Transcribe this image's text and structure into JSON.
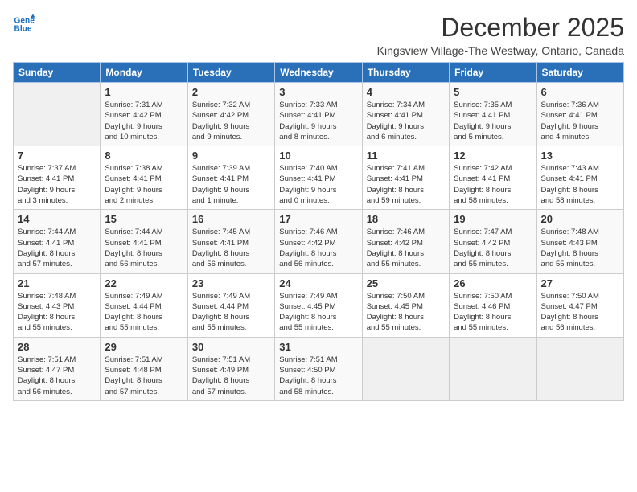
{
  "logo": {
    "line1": "General",
    "line2": "Blue"
  },
  "title": "December 2025",
  "location": "Kingsview Village-The Westway, Ontario, Canada",
  "days_of_week": [
    "Sunday",
    "Monday",
    "Tuesday",
    "Wednesday",
    "Thursday",
    "Friday",
    "Saturday"
  ],
  "weeks": [
    [
      {
        "day": "",
        "info": ""
      },
      {
        "day": "1",
        "info": "Sunrise: 7:31 AM\nSunset: 4:42 PM\nDaylight: 9 hours\nand 10 minutes."
      },
      {
        "day": "2",
        "info": "Sunrise: 7:32 AM\nSunset: 4:42 PM\nDaylight: 9 hours\nand 9 minutes."
      },
      {
        "day": "3",
        "info": "Sunrise: 7:33 AM\nSunset: 4:41 PM\nDaylight: 9 hours\nand 8 minutes."
      },
      {
        "day": "4",
        "info": "Sunrise: 7:34 AM\nSunset: 4:41 PM\nDaylight: 9 hours\nand 6 minutes."
      },
      {
        "day": "5",
        "info": "Sunrise: 7:35 AM\nSunset: 4:41 PM\nDaylight: 9 hours\nand 5 minutes."
      },
      {
        "day": "6",
        "info": "Sunrise: 7:36 AM\nSunset: 4:41 PM\nDaylight: 9 hours\nand 4 minutes."
      }
    ],
    [
      {
        "day": "7",
        "info": "Sunrise: 7:37 AM\nSunset: 4:41 PM\nDaylight: 9 hours\nand 3 minutes."
      },
      {
        "day": "8",
        "info": "Sunrise: 7:38 AM\nSunset: 4:41 PM\nDaylight: 9 hours\nand 2 minutes."
      },
      {
        "day": "9",
        "info": "Sunrise: 7:39 AM\nSunset: 4:41 PM\nDaylight: 9 hours\nand 1 minute."
      },
      {
        "day": "10",
        "info": "Sunrise: 7:40 AM\nSunset: 4:41 PM\nDaylight: 9 hours\nand 0 minutes."
      },
      {
        "day": "11",
        "info": "Sunrise: 7:41 AM\nSunset: 4:41 PM\nDaylight: 8 hours\nand 59 minutes."
      },
      {
        "day": "12",
        "info": "Sunrise: 7:42 AM\nSunset: 4:41 PM\nDaylight: 8 hours\nand 58 minutes."
      },
      {
        "day": "13",
        "info": "Sunrise: 7:43 AM\nSunset: 4:41 PM\nDaylight: 8 hours\nand 58 minutes."
      }
    ],
    [
      {
        "day": "14",
        "info": "Sunrise: 7:44 AM\nSunset: 4:41 PM\nDaylight: 8 hours\nand 57 minutes."
      },
      {
        "day": "15",
        "info": "Sunrise: 7:44 AM\nSunset: 4:41 PM\nDaylight: 8 hours\nand 56 minutes."
      },
      {
        "day": "16",
        "info": "Sunrise: 7:45 AM\nSunset: 4:41 PM\nDaylight: 8 hours\nand 56 minutes."
      },
      {
        "day": "17",
        "info": "Sunrise: 7:46 AM\nSunset: 4:42 PM\nDaylight: 8 hours\nand 56 minutes."
      },
      {
        "day": "18",
        "info": "Sunrise: 7:46 AM\nSunset: 4:42 PM\nDaylight: 8 hours\nand 55 minutes."
      },
      {
        "day": "19",
        "info": "Sunrise: 7:47 AM\nSunset: 4:42 PM\nDaylight: 8 hours\nand 55 minutes."
      },
      {
        "day": "20",
        "info": "Sunrise: 7:48 AM\nSunset: 4:43 PM\nDaylight: 8 hours\nand 55 minutes."
      }
    ],
    [
      {
        "day": "21",
        "info": "Sunrise: 7:48 AM\nSunset: 4:43 PM\nDaylight: 8 hours\nand 55 minutes."
      },
      {
        "day": "22",
        "info": "Sunrise: 7:49 AM\nSunset: 4:44 PM\nDaylight: 8 hours\nand 55 minutes."
      },
      {
        "day": "23",
        "info": "Sunrise: 7:49 AM\nSunset: 4:44 PM\nDaylight: 8 hours\nand 55 minutes."
      },
      {
        "day": "24",
        "info": "Sunrise: 7:49 AM\nSunset: 4:45 PM\nDaylight: 8 hours\nand 55 minutes."
      },
      {
        "day": "25",
        "info": "Sunrise: 7:50 AM\nSunset: 4:45 PM\nDaylight: 8 hours\nand 55 minutes."
      },
      {
        "day": "26",
        "info": "Sunrise: 7:50 AM\nSunset: 4:46 PM\nDaylight: 8 hours\nand 55 minutes."
      },
      {
        "day": "27",
        "info": "Sunrise: 7:50 AM\nSunset: 4:47 PM\nDaylight: 8 hours\nand 56 minutes."
      }
    ],
    [
      {
        "day": "28",
        "info": "Sunrise: 7:51 AM\nSunset: 4:47 PM\nDaylight: 8 hours\nand 56 minutes."
      },
      {
        "day": "29",
        "info": "Sunrise: 7:51 AM\nSunset: 4:48 PM\nDaylight: 8 hours\nand 57 minutes."
      },
      {
        "day": "30",
        "info": "Sunrise: 7:51 AM\nSunset: 4:49 PM\nDaylight: 8 hours\nand 57 minutes."
      },
      {
        "day": "31",
        "info": "Sunrise: 7:51 AM\nSunset: 4:50 PM\nDaylight: 8 hours\nand 58 minutes."
      },
      {
        "day": "",
        "info": ""
      },
      {
        "day": "",
        "info": ""
      },
      {
        "day": "",
        "info": ""
      }
    ]
  ]
}
